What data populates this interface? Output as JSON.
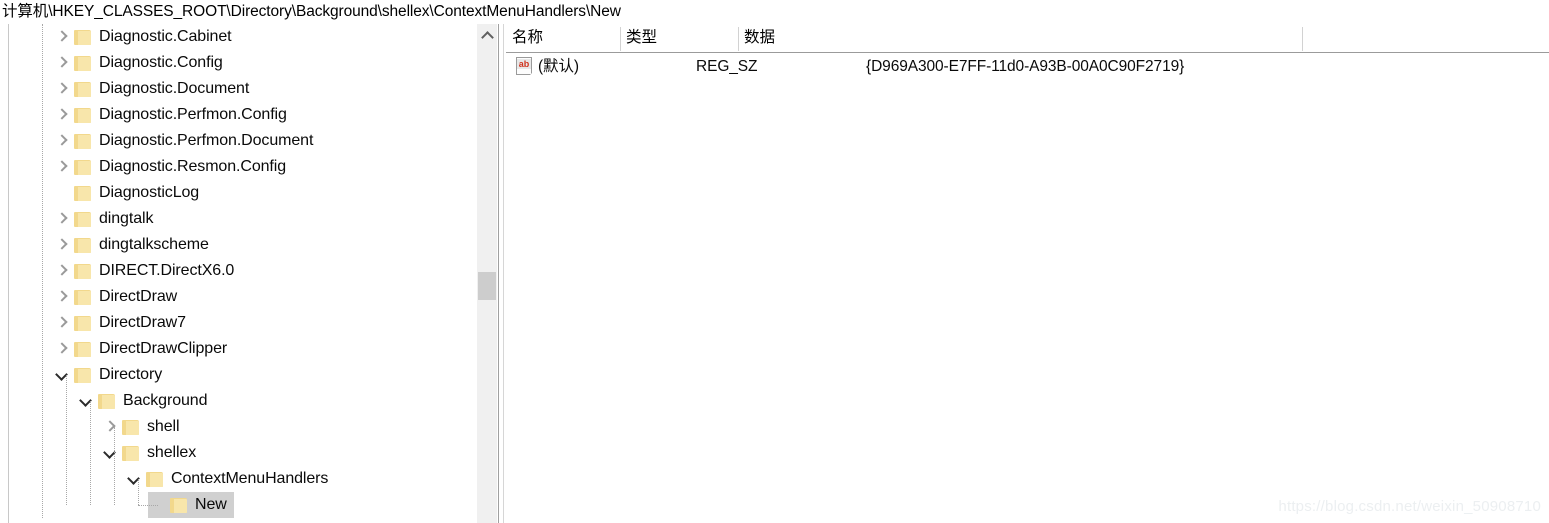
{
  "window": {
    "address_path": "计算机\\HKEY_CLASSES_ROOT\\Directory\\Background\\shellex\\ContextMenuHandlers\\New"
  },
  "tree": {
    "items": [
      {
        "label": "Diagnostic.Cabinet",
        "depth": 1,
        "state": "collapsed",
        "selected": false
      },
      {
        "label": "Diagnostic.Config",
        "depth": 1,
        "state": "collapsed",
        "selected": false
      },
      {
        "label": "Diagnostic.Document",
        "depth": 1,
        "state": "collapsed",
        "selected": false
      },
      {
        "label": "Diagnostic.Perfmon.Config",
        "depth": 1,
        "state": "collapsed",
        "selected": false
      },
      {
        "label": "Diagnostic.Perfmon.Document",
        "depth": 1,
        "state": "collapsed",
        "selected": false
      },
      {
        "label": "Diagnostic.Resmon.Config",
        "depth": 1,
        "state": "collapsed",
        "selected": false
      },
      {
        "label": "DiagnosticLog",
        "depth": 1,
        "state": "leaf",
        "selected": false
      },
      {
        "label": "dingtalk",
        "depth": 1,
        "state": "collapsed",
        "selected": false
      },
      {
        "label": "dingtalkscheme",
        "depth": 1,
        "state": "collapsed",
        "selected": false
      },
      {
        "label": "DIRECT.DirectX6.0",
        "depth": 1,
        "state": "collapsed",
        "selected": false
      },
      {
        "label": "DirectDraw",
        "depth": 1,
        "state": "collapsed",
        "selected": false
      },
      {
        "label": "DirectDraw7",
        "depth": 1,
        "state": "collapsed",
        "selected": false
      },
      {
        "label": "DirectDrawClipper",
        "depth": 1,
        "state": "collapsed",
        "selected": false
      },
      {
        "label": "Directory",
        "depth": 1,
        "state": "expanded",
        "selected": false
      },
      {
        "label": "Background",
        "depth": 2,
        "state": "expanded",
        "selected": false
      },
      {
        "label": "shell",
        "depth": 3,
        "state": "collapsed",
        "selected": false
      },
      {
        "label": "shellex",
        "depth": 3,
        "state": "expanded",
        "selected": false
      },
      {
        "label": "ContextMenuHandlers",
        "depth": 4,
        "state": "expanded",
        "selected": false
      },
      {
        "label": "New",
        "depth": 5,
        "state": "leaf",
        "selected": true
      }
    ]
  },
  "values": {
    "columns": [
      "名称",
      "类型",
      "数据"
    ],
    "rows": [
      {
        "icon": "string-value-ab-icon",
        "name": "(默认)",
        "type": "REG_SZ",
        "data": "{D969A300-E7FF-11d0-A93B-00A0C90F2719}"
      }
    ]
  },
  "scrollbar": {
    "up_arrow": "scroll-up-arrow"
  },
  "watermark": {
    "text": "https://blog.csdn.net/weixin_50908710"
  }
}
